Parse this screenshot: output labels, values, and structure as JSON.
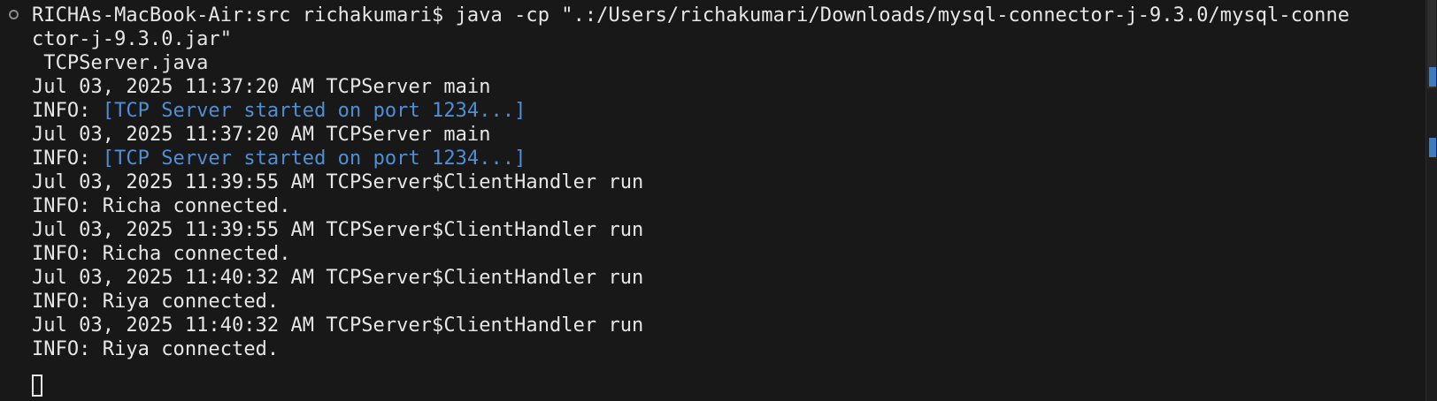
{
  "terminal": {
    "prompt_line_1": "RICHAs-MacBook-Air:src richakumari$ java -cp \".:/Users/richakumari/Downloads/mysql-connector-j-9.3.0/mysql-conne",
    "prompt_line_2": "ctor-j-9.3.0.jar\"",
    "prompt_line_3": " TCPServer.java",
    "log": [
      {
        "header": "Jul 03, 2025 11:37:20 AM TCPServer main",
        "prefix": "INFO: ",
        "message": "[TCP Server started on port 1234...]",
        "highlight": true
      },
      {
        "header": "Jul 03, 2025 11:37:20 AM TCPServer main",
        "prefix": "INFO: ",
        "message": "[TCP Server started on port 1234...]",
        "highlight": true
      },
      {
        "header": "Jul 03, 2025 11:39:55 AM TCPServer$ClientHandler run",
        "prefix": "INFO: ",
        "message": "Richa connected.",
        "highlight": false
      },
      {
        "header": "Jul 03, 2025 11:39:55 AM TCPServer$ClientHandler run",
        "prefix": "INFO: ",
        "message": "Richa connected.",
        "highlight": false
      },
      {
        "header": "Jul 03, 2025 11:40:32 AM TCPServer$ClientHandler run",
        "prefix": "INFO: ",
        "message": "Riya connected.",
        "highlight": false
      },
      {
        "header": "Jul 03, 2025 11:40:32 AM TCPServer$ClientHandler run",
        "prefix": "INFO: ",
        "message": "Riya connected.",
        "highlight": false
      }
    ]
  },
  "colors": {
    "background": "#181818",
    "text": "#e6e6e6",
    "info_highlight": "#4e8fd6",
    "scroll_marker": "#3b7bbf"
  },
  "icons": {
    "command_marker": "circle-outline-icon"
  }
}
